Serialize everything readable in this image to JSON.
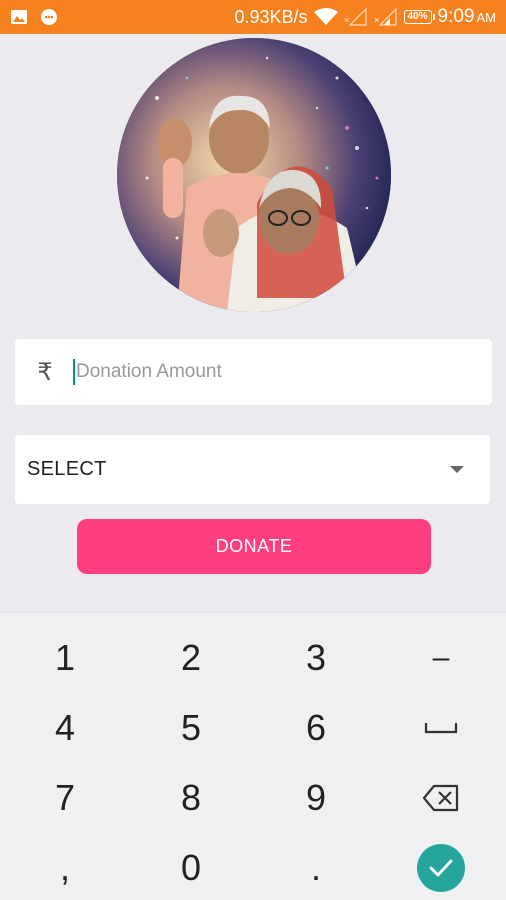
{
  "status_bar": {
    "speed": "0.93KB/s",
    "battery": "40%",
    "time": "9:09",
    "ampm": "AM",
    "color": "#f5821f"
  },
  "amount": {
    "currency_symbol": "₹",
    "placeholder": "Donation Amount"
  },
  "select": {
    "label": "SELECT"
  },
  "donate": {
    "label": "DONATE",
    "color": "#ff3d7f"
  },
  "keyboard": {
    "rows": [
      [
        "1",
        "2",
        "3",
        "–"
      ],
      [
        "4",
        "5",
        "6",
        "space-icon"
      ],
      [
        "7",
        "8",
        "9",
        "backspace-icon"
      ],
      [
        ",",
        "0",
        ".",
        "done-icon"
      ]
    ],
    "keys": {
      "k1": "1",
      "k2": "2",
      "k3": "3",
      "dash": "–",
      "k4": "4",
      "k5": "5",
      "k6": "6",
      "k7": "7",
      "k8": "8",
      "k9": "9",
      "comma": ",",
      "k0": "0",
      "period": "."
    },
    "done_color": "#26a69a"
  }
}
